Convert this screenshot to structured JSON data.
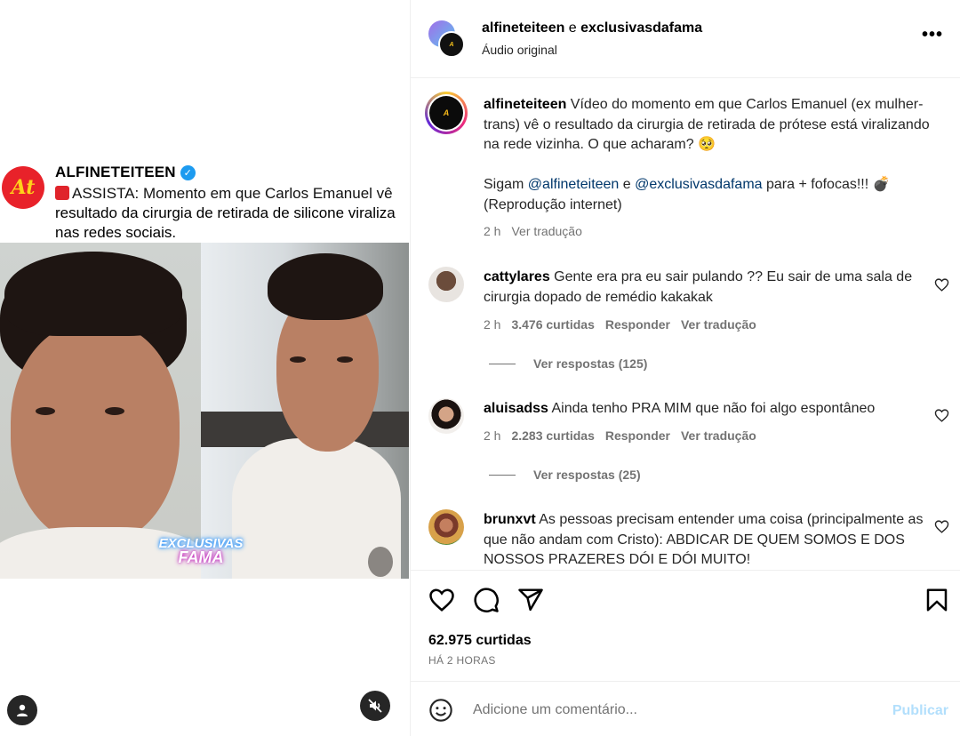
{
  "media": {
    "tweet": {
      "name": "ALFINETEITEEN",
      "avatar_text": "At",
      "text_line1": "ASSISTA: Momento em que Carlos Emanuel vê",
      "text_rest": "resultado da cirurgia de retirada de silicone viraliza nas redes sociais."
    },
    "watermark": {
      "line1": "EXCLUSIVAS",
      "line2": "FAMA"
    },
    "icons": {
      "user_tag": "user-icon",
      "mute": "muted-speaker-icon"
    }
  },
  "header": {
    "author1": "alfineteiteen",
    "connector": " e ",
    "author2": "exclusivasdafama",
    "audio": "Áudio original",
    "more": "•••"
  },
  "caption": {
    "username": "alfineteiteen",
    "text": " Vídeo do momento em que Carlos Emanuel (ex mulher-trans) vê o resultado da cirurgia de retirada de prótese está viralizando na rede vizinha. O que acharam? 🥺",
    "follow_prefix": "Sigam ",
    "mention1": "@alfineteiteen",
    "follow_mid": " e ",
    "mention2": "@exclusivasdafama",
    "follow_suffix": " para + fofocas!!! 💣",
    "credit": "(Reprodução internet)",
    "time": "2 h",
    "translate": "Ver tradução"
  },
  "comments": [
    {
      "username": "cattylares",
      "text": " Gente era pra eu sair pulando ?? Eu sair de uma sala de cirurgia dopado de remédio kakakak",
      "time": "2 h",
      "likes": "3.476 curtidas",
      "reply": "Responder",
      "translate": "Ver tradução",
      "replies": "Ver respostas (125)"
    },
    {
      "username": "aluisadss",
      "text": " Ainda tenho PRA MIM que não foi algo espontâneo",
      "time": "2 h",
      "likes": "2.283 curtidas",
      "reply": "Responder",
      "translate": "Ver tradução",
      "replies": "Ver respostas (25)"
    },
    {
      "username": "brunxvt",
      "text": " As pessoas precisam entender uma coisa (principalmente as que não andam com Cristo): ABDICAR DE QUEM SOMOS E DOS NOSSOS PRAZERES DÓI E DÓI MUITO!"
    }
  ],
  "actions": {
    "likes": "62.975 curtidas",
    "posted": "HÁ 2 HORAS",
    "icons": [
      "heart-icon",
      "comment-icon",
      "share-icon",
      "bookmark-icon"
    ]
  },
  "composer": {
    "placeholder": "Adicione um comentário...",
    "publish": "Publicar"
  },
  "colors": {
    "link": "#00376b",
    "muted": "#737373",
    "publish_disabled": "#b2dffc"
  }
}
